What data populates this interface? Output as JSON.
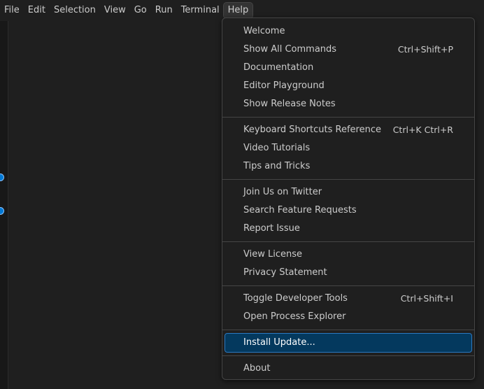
{
  "menubar": {
    "items": [
      "File",
      "Edit",
      "Selection",
      "View",
      "Go",
      "Run",
      "Terminal",
      "Help"
    ],
    "active": "Help"
  },
  "help_menu": {
    "groups": [
      [
        {
          "label": "Welcome",
          "shortcut": ""
        },
        {
          "label": "Show All Commands",
          "shortcut": "Ctrl+Shift+P"
        },
        {
          "label": "Documentation",
          "shortcut": ""
        },
        {
          "label": "Editor Playground",
          "shortcut": ""
        },
        {
          "label": "Show Release Notes",
          "shortcut": ""
        }
      ],
      [
        {
          "label": "Keyboard Shortcuts Reference",
          "shortcut": "Ctrl+K Ctrl+R"
        },
        {
          "label": "Video Tutorials",
          "shortcut": ""
        },
        {
          "label": "Tips and Tricks",
          "shortcut": ""
        }
      ],
      [
        {
          "label": "Join Us on Twitter",
          "shortcut": ""
        },
        {
          "label": "Search Feature Requests",
          "shortcut": ""
        },
        {
          "label": "Report Issue",
          "shortcut": ""
        }
      ],
      [
        {
          "label": "View License",
          "shortcut": ""
        },
        {
          "label": "Privacy Statement",
          "shortcut": ""
        }
      ],
      [
        {
          "label": "Toggle Developer Tools",
          "shortcut": "Ctrl+Shift+I"
        },
        {
          "label": "Open Process Explorer",
          "shortcut": ""
        }
      ],
      [
        {
          "label": "Install Update...",
          "shortcut": "",
          "highlighted": true
        }
      ],
      [
        {
          "label": "About",
          "shortcut": ""
        }
      ]
    ]
  },
  "colors": {
    "background": "#1f1f1f",
    "highlight": "#04395e",
    "accent": "#0078d4",
    "separator": "#454545"
  }
}
